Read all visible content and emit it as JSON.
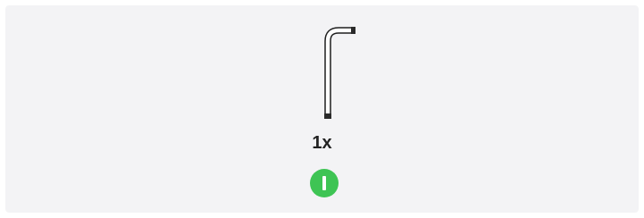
{
  "part": {
    "icon": "allen-key-icon",
    "quantity_label": "1x"
  },
  "step_marker": {
    "icon": "step-marker-icon",
    "color": "#3ec454"
  },
  "colors": {
    "panel_background": "#f3f3f5",
    "tool_stroke": "#1e1e1e",
    "text": "#222222"
  }
}
